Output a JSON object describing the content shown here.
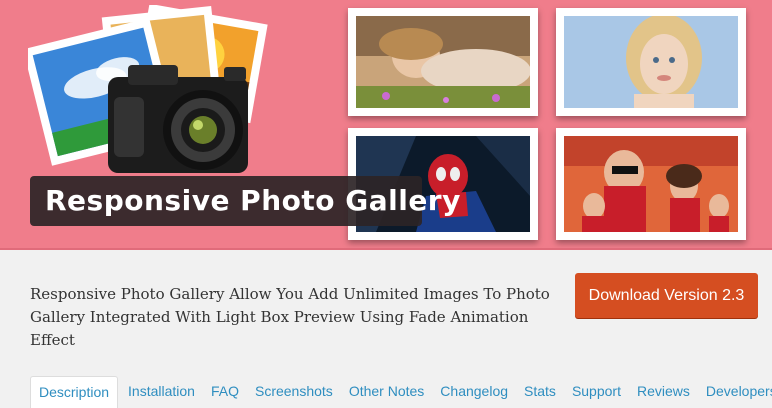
{
  "banner": {
    "title": "Responsive Photo Gallery",
    "background_color": "#f07d8b",
    "logo_icon": "camera-with-photos-icon",
    "tiles": [
      "woman-lying-in-grass",
      "blonde-woman-portrait",
      "spider-man-artwork",
      "incredibles-family"
    ]
  },
  "description": "Responsive Photo Gallery Allow You Add Unlimited Images To Photo Gallery Integrated With Light Box Preview Using Fade Animation Effect",
  "download": {
    "label": "Download Version 2.3",
    "color": "#d54e21"
  },
  "tabs": [
    {
      "label": "Description",
      "active": true
    },
    {
      "label": "Installation"
    },
    {
      "label": "FAQ"
    },
    {
      "label": "Screenshots"
    },
    {
      "label": "Other Notes"
    },
    {
      "label": "Changelog"
    },
    {
      "label": "Stats"
    },
    {
      "label": "Support"
    },
    {
      "label": "Reviews"
    },
    {
      "label": "Developers"
    }
  ],
  "accent_link_color": "#2f8ec0"
}
